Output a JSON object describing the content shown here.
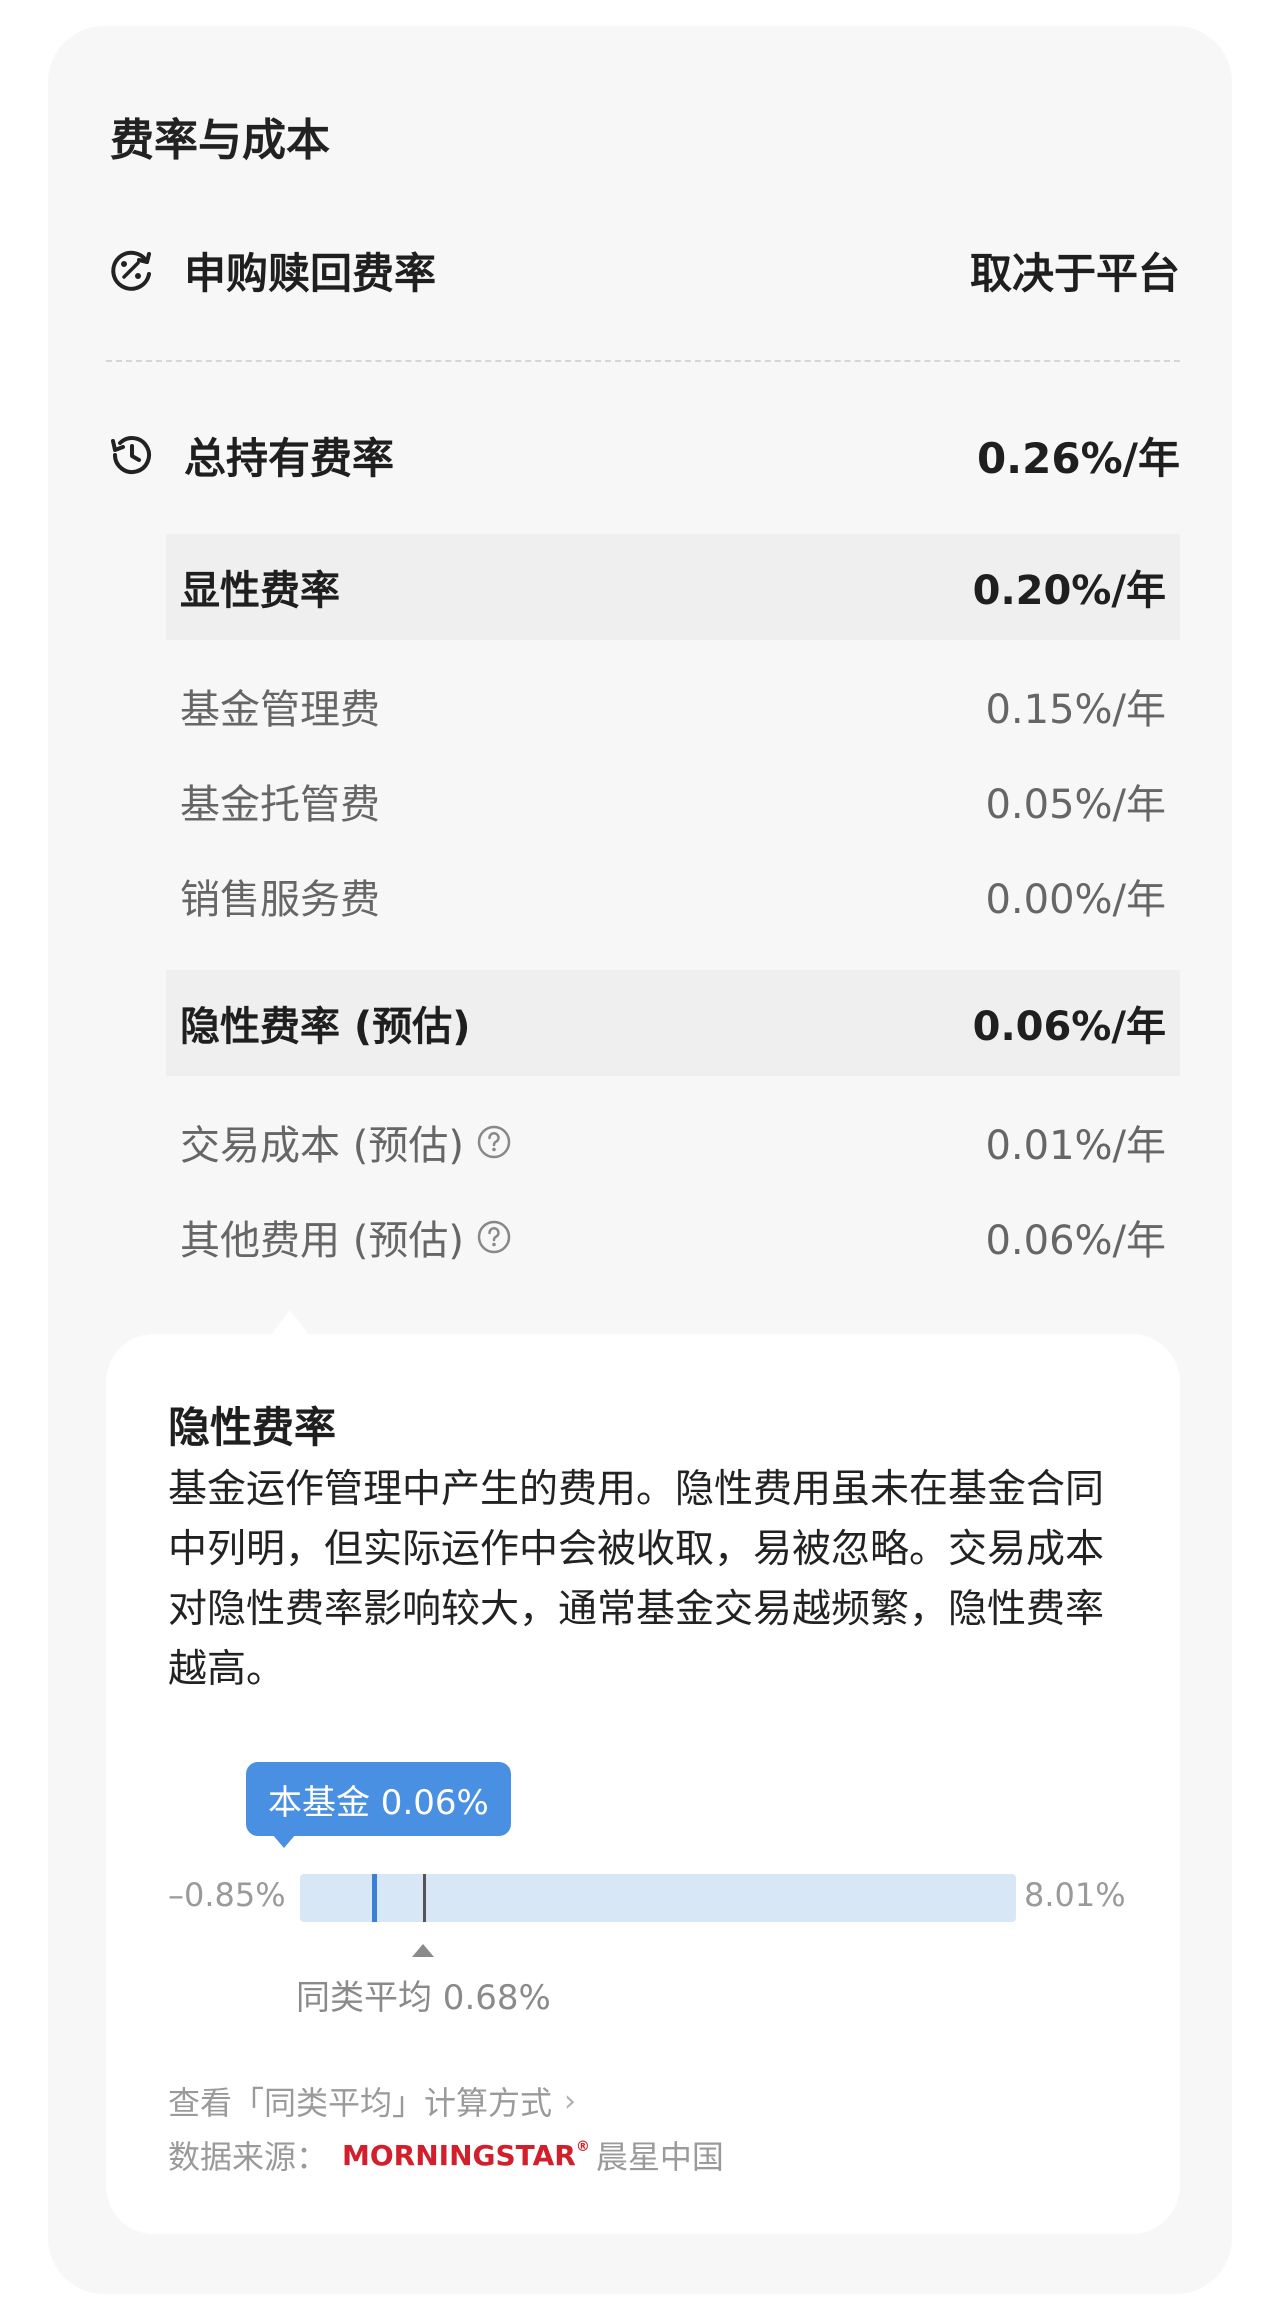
{
  "section": {
    "title": "费率与成本"
  },
  "subscription": {
    "label": "申购赎回费率",
    "value": "取决于平台"
  },
  "total": {
    "label": "总持有费率",
    "value": "0.26%/年"
  },
  "explicit": {
    "label": "显性费率",
    "value": "0.20%/年",
    "items": [
      {
        "label": "基金管理费",
        "value": "0.15%/年"
      },
      {
        "label": "基金托管费",
        "value": "0.05%/年"
      },
      {
        "label": "销售服务费",
        "value": "0.00%/年"
      }
    ]
  },
  "implicit": {
    "label": "隐性费率 (预估)",
    "value": "0.06%/年",
    "items": [
      {
        "label": "交易成本 (预估)",
        "value": "0.01%/年"
      },
      {
        "label": "其他费用 (预估)",
        "value": "0.06%/年"
      }
    ]
  },
  "tooltip": {
    "title": "隐性费率",
    "body": "基金运作管理中产生的费用。隐性费用虽未在基金合同中列明，但实际运作中会被收取，易被忽略。交易成本对隐性费率影响较大，通常基金交易越频繁，隐性费率越高。"
  },
  "range_chart": {
    "min_label": "–0.85%",
    "max_label": "8.01%",
    "min": -0.85,
    "max": 8.01,
    "fund_label": "本基金 0.06%",
    "fund_value": 0.06,
    "avg_label": "同类平均 0.68%",
    "avg_value": 0.68,
    "bar_color": "#d8e7f6",
    "fund_color": "#3b7fd6"
  },
  "footer": {
    "calc_link": "查看「同类平均」计算方式",
    "source_label": "数据来源：",
    "source_logo": "MORNINGSTAR",
    "source_cn": "晨星中国"
  }
}
